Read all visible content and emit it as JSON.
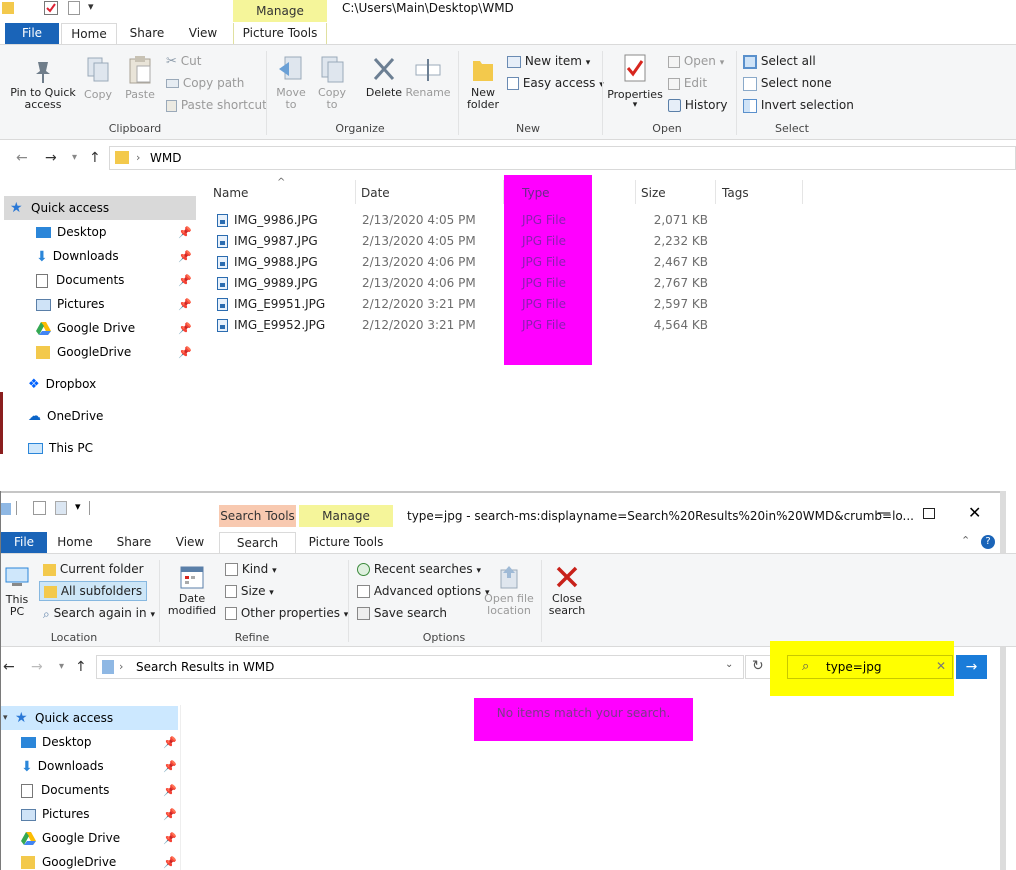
{
  "window1": {
    "title_path": "C:\\Users\\Main\\Desktop\\WMD",
    "context_header": "Manage",
    "tabs": [
      "File",
      "Home",
      "Share",
      "View",
      "Picture Tools"
    ],
    "ribbon": {
      "clipboard": {
        "label": "Clipboard",
        "pin": "Pin to Quick access",
        "copy": "Copy",
        "paste": "Paste",
        "cut": "Cut",
        "copy_path": "Copy path",
        "paste_shortcut": "Paste shortcut"
      },
      "organize": {
        "label": "Organize",
        "move_to": "Move to",
        "copy_to": "Copy to",
        "delete": "Delete",
        "rename": "Rename"
      },
      "new": {
        "label": "New",
        "new_folder": "New folder",
        "new_item": "New item",
        "easy_access": "Easy access"
      },
      "open": {
        "label": "Open",
        "properties": "Properties",
        "open": "Open",
        "edit": "Edit",
        "history": "History"
      },
      "select": {
        "label": "Select",
        "select_all": "Select all",
        "select_none": "Select none",
        "invert": "Invert selection"
      }
    },
    "breadcrumb": "WMD",
    "nav": {
      "quick_access": "Quick access",
      "items": [
        "Desktop",
        "Downloads",
        "Documents",
        "Pictures",
        "Google Drive",
        "GoogleDrive"
      ],
      "dropbox": "Dropbox",
      "onedrive": "OneDrive",
      "thispc": "This PC"
    },
    "columns": {
      "name": "Name",
      "date": "Date",
      "type": "Type",
      "size": "Size",
      "tags": "Tags"
    },
    "files": [
      {
        "name": "IMG_9986.JPG",
        "date": "2/13/2020 4:05 PM",
        "type": "JPG File",
        "size": "2,071 KB"
      },
      {
        "name": "IMG_9987.JPG",
        "date": "2/13/2020 4:05 PM",
        "type": "JPG File",
        "size": "2,232 KB"
      },
      {
        "name": "IMG_9988.JPG",
        "date": "2/13/2020 4:06 PM",
        "type": "JPG File",
        "size": "2,467 KB"
      },
      {
        "name": "IMG_9989.JPG",
        "date": "2/13/2020 4:06 PM",
        "type": "JPG File",
        "size": "2,767 KB"
      },
      {
        "name": "IMG_E9951.JPG",
        "date": "2/12/2020 3:21 PM",
        "type": "JPG File",
        "size": "2,597 KB"
      },
      {
        "name": "IMG_E9952.JPG",
        "date": "2/12/2020 3:21 PM",
        "type": "JPG File",
        "size": "4,564 KB"
      }
    ]
  },
  "window2": {
    "title": "type=jpg - search-ms:displayname=Search%20Results%20in%20WMD&crumb=lo...",
    "ctx_search_tools": "Search Tools",
    "ctx_manage": "Manage",
    "tabs": [
      "File",
      "Home",
      "Share",
      "View",
      "Search",
      "Picture Tools"
    ],
    "ribbon": {
      "location": {
        "label": "Location",
        "this_pc": "This PC",
        "current_folder": "Current folder",
        "all_subfolders": "All subfolders",
        "search_again": "Search again in"
      },
      "refine": {
        "label": "Refine",
        "date_modified": "Date modified",
        "kind": "Kind",
        "size": "Size",
        "other_props": "Other properties"
      },
      "options": {
        "label": "Options",
        "recent": "Recent searches",
        "advanced": "Advanced options",
        "save": "Save search",
        "open_loc": "Open file location",
        "close": "Close search"
      }
    },
    "breadcrumb": "Search Results in WMD",
    "search_value": "type=jpg",
    "empty_message": "No items match your search.",
    "nav": {
      "quick_access": "Quick access",
      "items": [
        "Desktop",
        "Downloads",
        "Documents",
        "Pictures",
        "Google Drive",
        "GoogleDrive"
      ]
    }
  },
  "colors": {
    "accent": "#1a64b8",
    "highlight_magenta": "#ff00ff",
    "highlight_yellow": "#ffff00",
    "manage_tab": "#f5f59a",
    "search_tools_tab": "#f8c9b0"
  }
}
